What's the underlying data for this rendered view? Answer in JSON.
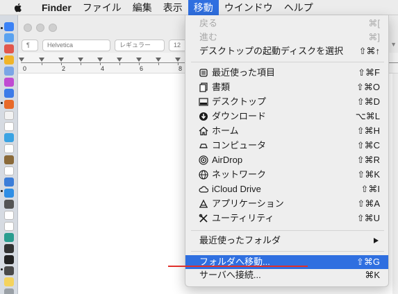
{
  "menubar": {
    "apple_icon": "apple-logo",
    "items": [
      {
        "label": "Finder"
      },
      {
        "label": "ファイル"
      },
      {
        "label": "編集"
      },
      {
        "label": "表示"
      },
      {
        "label": "移動"
      },
      {
        "label": "ウインドウ"
      },
      {
        "label": "ヘルプ"
      }
    ]
  },
  "toolbar": {
    "paragraph_style": "¶",
    "font_name": "Helvetica",
    "font_style": "レギュラー",
    "font_size": "12"
  },
  "ruler": {
    "numbers": [
      "0",
      "2",
      "4",
      "6",
      "8"
    ]
  },
  "go_menu": {
    "top_items": [
      {
        "label": "戻る",
        "shortcut": "⌘[",
        "disabled": true
      },
      {
        "label": "進む",
        "shortcut": "⌘]",
        "disabled": true
      },
      {
        "label": "デスクトップの起動ディスクを選択",
        "shortcut": "⇧⌘↑",
        "disabled": false
      }
    ],
    "places": [
      {
        "label": "最近使った項目",
        "shortcut": "⇧⌘F",
        "icon": "recents-icon"
      },
      {
        "label": "書類",
        "shortcut": "⇧⌘O",
        "icon": "documents-icon"
      },
      {
        "label": "デスクトップ",
        "shortcut": "⇧⌘D",
        "icon": "desktop-icon"
      },
      {
        "label": "ダウンロード",
        "shortcut": "⌥⌘L",
        "icon": "downloads-icon"
      },
      {
        "label": "ホーム",
        "shortcut": "⇧⌘H",
        "icon": "home-icon"
      },
      {
        "label": "コンピュータ",
        "shortcut": "⇧⌘C",
        "icon": "computer-icon"
      },
      {
        "label": "AirDrop",
        "shortcut": "⇧⌘R",
        "icon": "airdrop-icon"
      },
      {
        "label": "ネットワーク",
        "shortcut": "⇧⌘K",
        "icon": "network-icon"
      },
      {
        "label": "iCloud Drive",
        "shortcut": "⇧⌘I",
        "icon": "icloud-icon"
      },
      {
        "label": "アプリケーション",
        "shortcut": "⇧⌘A",
        "icon": "applications-icon"
      },
      {
        "label": "ユーティリティ",
        "shortcut": "⇧⌘U",
        "icon": "utilities-icon"
      }
    ],
    "recent_folders": {
      "label": "最近使ったフォルダ"
    },
    "goto_folder": {
      "label": "フォルダへ移動...",
      "shortcut": "⇧⌘G"
    },
    "connect_server": {
      "label": "サーバへ接続...",
      "shortcut": "⌘K"
    }
  },
  "colors": {
    "accent": "#2f6fe0",
    "annotation_line": "#e0302a"
  }
}
